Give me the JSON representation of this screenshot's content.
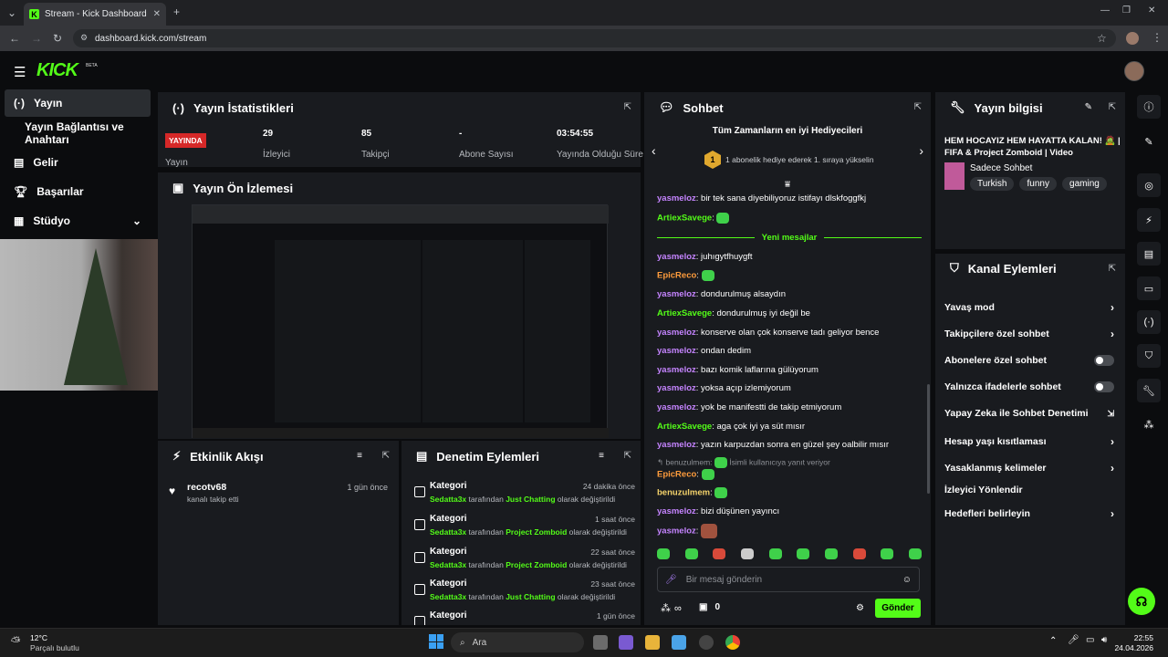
{
  "browser": {
    "tab_title": "Stream - Kick Dashboard",
    "url": "dashboard.kick.com/stream",
    "new_tab": "+"
  },
  "header": {
    "logo": "KICK",
    "beta": "BETA"
  },
  "sidebar": {
    "items": [
      {
        "label": "Yayın",
        "icon": "broadcast-icon"
      },
      {
        "label": "Yayın Bağlantısı ve Anahtarı",
        "icon": "key-icon"
      },
      {
        "label": "Gelir",
        "icon": "revenue-icon"
      },
      {
        "label": "Başarılar",
        "icon": "trophy-icon"
      },
      {
        "label": "Stüdyo",
        "icon": "studio-icon"
      }
    ]
  },
  "stats": {
    "title": "Yayın İstatistikleri",
    "live_badge": "YAYINDA",
    "live_label": "Yayın",
    "items": [
      {
        "value": "29",
        "label": "İzleyici"
      },
      {
        "value": "85",
        "label": "Takipçi"
      },
      {
        "value": "-",
        "label": "Abone Sayısı"
      },
      {
        "value": "03:54:55",
        "label": "Yayında Olduğu Süre"
      }
    ]
  },
  "preview": {
    "title": "Yayın Ön İzlemesi"
  },
  "activity": {
    "title": "Etkinlik Akışı",
    "items": [
      {
        "user": "recotv68",
        "text": "kanalı takip etti",
        "time": "1 gün önce"
      }
    ]
  },
  "moderation": {
    "title": "Denetim Eylemleri",
    "items": [
      {
        "title": "Kategori",
        "time": "24 dakika önce",
        "user": "Sedatta3x",
        "mid": "tarafından",
        "cat": "Just Chatting",
        "tail": "olarak değiştirildi"
      },
      {
        "title": "Kategori",
        "time": "1 saat önce",
        "user": "Sedatta3x",
        "mid": "tarafından",
        "cat": "Project Zomboid",
        "tail": "olarak değiştirildi"
      },
      {
        "title": "Kategori",
        "time": "22 saat önce",
        "user": "Sedatta3x",
        "mid": "tarafından",
        "cat": "Project Zomboid",
        "tail": "olarak değiştirildi"
      },
      {
        "title": "Kategori",
        "time": "23 saat önce",
        "user": "Sedatta3x",
        "mid": "tarafından",
        "cat": "Just Chatting",
        "tail": "olarak değiştirildi"
      },
      {
        "title": "Kategori",
        "time": "1 gün önce"
      }
    ]
  },
  "chat": {
    "title": "Sohbet",
    "top_gifters_title": "Tüm Zamanların en iyi Hediyecileri",
    "top_gifters_rank": "1",
    "top_gifters_text": "1 abonelik hediye ederek 1. sıraya yükselin",
    "new_messages": "Yeni mesajlar",
    "messages": [
      {
        "user": "yasmeloz",
        "color": "p",
        "text": ": bir tek sana diyebiliyoruz istifayı dlskfoggfkj"
      },
      {
        "user": "ArtiexSavege",
        "color": "g",
        "text": ":",
        "emote": true
      },
      {
        "user": "yasmeloz",
        "color": "p",
        "text": ": juhıgytfhuygft"
      },
      {
        "user": "EpicReco",
        "color": "o",
        "text": ":",
        "emote": true
      },
      {
        "user": "yasmeloz",
        "color": "p",
        "text": ": dondurulmuş alsaydın"
      },
      {
        "user": "ArtiexSavege",
        "color": "g",
        "text": ": dondurulmuş iyi değil be"
      },
      {
        "user": "yasmeloz",
        "color": "p",
        "text": ": konserve olan çok konserve tadı geliyor bence"
      },
      {
        "user": "yasmeloz",
        "color": "p",
        "text": ": ondan dedim"
      },
      {
        "user": "yasmeloz",
        "color": "p",
        "text": ": bazı komik laflarına gülüyorum"
      },
      {
        "user": "yasmeloz",
        "color": "p",
        "text": ": yoksa açıp izlemiyorum"
      },
      {
        "user": "yasmeloz",
        "color": "p",
        "text": ": yok be manifestti de takip etmiyorum"
      },
      {
        "user": "ArtiexSavege",
        "color": "g",
        "text": ": aga çok iyi ya süt mısır"
      },
      {
        "user": "yasmeloz",
        "color": "p",
        "text": ": yazın karpuzdan sonra en güzel şey oalbilir mısır"
      }
    ],
    "reply_hint_user": "benuzulmem:",
    "reply_hint_text": "İsimli kullanıcıya yanıt veriyor",
    "messages2": [
      {
        "user": "EpicReco",
        "color": "o",
        "text": ":",
        "emote": true
      },
      {
        "user": "benuzulmem",
        "color": "y",
        "text": ":",
        "emote": true
      },
      {
        "user": "yasmeloz",
        "color": "p",
        "text": ": bizi düşünen yayıncı"
      },
      {
        "user": "yasmeloz",
        "color": "p",
        "text": ":",
        "emote": true
      }
    ],
    "input_placeholder": "Bir mesaj gönderin",
    "points": "∞",
    "chest_count": "0",
    "send": "Gönder"
  },
  "stream_info": {
    "title": "Yayın bilgisi",
    "stream_title": "HEM HOCAYIZ HEM HAYATTA KALAN! 🧟 | FIFA & Project Zomboid | Video",
    "category": "Sadece Sohbet",
    "tags": [
      "Turkish",
      "funny",
      "gaming"
    ]
  },
  "channel_actions": {
    "title": "Kanal Eylemleri",
    "items": [
      {
        "label": "Yavaş mod",
        "ctrl": "chev"
      },
      {
        "label": "Takipçilere özel sohbet",
        "ctrl": "chev"
      },
      {
        "label": "Abonelere özel sohbet",
        "ctrl": "toggle"
      },
      {
        "label": "Yalnızca ifadelerle sohbet",
        "ctrl": "toggle"
      },
      {
        "label": "Yapay Zeka ile Sohbet Denetimi",
        "ctrl": "ext"
      },
      {
        "label": "Hesap yaşı kısıtlaması",
        "ctrl": "chev"
      },
      {
        "label": "Yasaklanmış kelimeler",
        "ctrl": "chev"
      },
      {
        "label": "İzleyici Yönlendir",
        "ctrl": ""
      },
      {
        "label": "Hedefleri belirleyin",
        "ctrl": "chev"
      }
    ]
  },
  "taskbar": {
    "weather_temp": "12°C",
    "weather_desc": "Parçalı bulutlu",
    "search": "Ara",
    "time": "22:55",
    "date": "24.04.2026"
  },
  "colors": {
    "accent": "#53fc18",
    "panel": "#191b1f",
    "bg": "#0b0c0e"
  }
}
